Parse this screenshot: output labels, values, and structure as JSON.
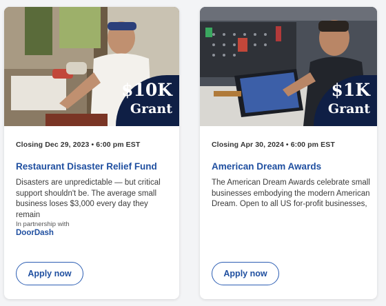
{
  "cards": [
    {
      "image_alt": "Chef cooking in a restaurant kitchen",
      "grant_amount": "$10K",
      "grant_label": "Grant",
      "closing": "Closing Dec 29, 2023 • 6:00 pm EST",
      "title": "Restaurant Disaster Relief Fund",
      "description": "Disasters are unpredictable — but critical support shouldn't be. The average small business loses $3,000 every day they remain",
      "partner_label": "In partnership with",
      "partner_name": "DoorDash",
      "apply_label": "Apply now"
    },
    {
      "image_alt": "Tattooed artist drawing on a tablet in a studio",
      "grant_amount": "$1K",
      "grant_label": "Grant",
      "closing": "Closing Apr 30, 2024 • 6:00 pm EST",
      "title": "American Dream Awards",
      "description": "The American Dream Awards celebrate small businesses embodying the modern American Dream. Open to all US for-profit businesses,",
      "apply_label": "Apply now"
    }
  ],
  "colors": {
    "badge": "#0f1f45",
    "link": "#1f4fa0",
    "button_border": "#2b5db3"
  }
}
